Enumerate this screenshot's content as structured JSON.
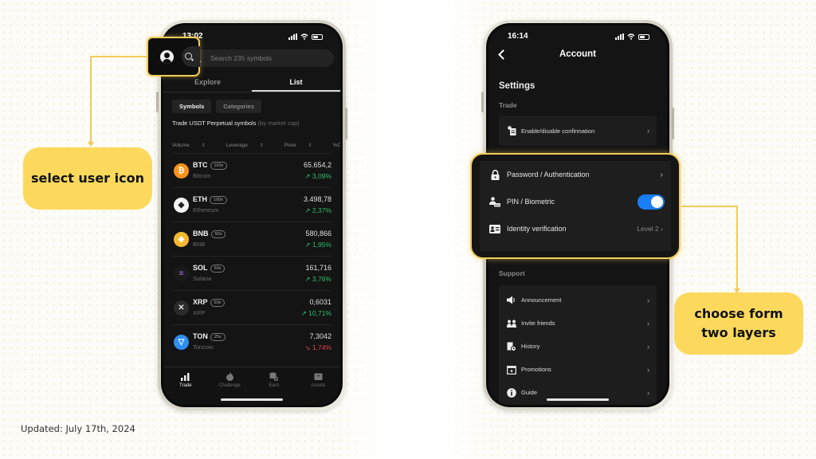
{
  "annotations": {
    "left_bubble": "select user icon",
    "right_bubble": "choose form two layers",
    "updated_label": "Updated: July 17th, 2024"
  },
  "phone_left": {
    "status_time": "13:02",
    "search_placeholder": "Search 235 symbols",
    "tabs": [
      {
        "label": "Explore",
        "active": false
      },
      {
        "label": "List",
        "active": true
      }
    ],
    "chips": [
      {
        "label": "Symbols",
        "active": true
      },
      {
        "label": "Categories",
        "active": false
      }
    ],
    "description": "Trade USDT Perpetual symbols",
    "description_muted": "(by market cap)",
    "column_headers": [
      "Volume",
      "Leverage",
      "Price",
      "%Change"
    ],
    "sort_glyph": "⇕",
    "coins": [
      {
        "symbol": "BTC",
        "leverage": "100x",
        "name": "Bitcoin",
        "price": "65.654,2",
        "change": "↗ 3,09%",
        "direction": "up",
        "logo_color": "#f7931a",
        "logo_glyph": "₿"
      },
      {
        "symbol": "ETH",
        "leverage": "100x",
        "name": "Ethereum",
        "price": "3.498,78",
        "change": "↗ 2,37%",
        "direction": "up",
        "logo_color": "#f4f4f4",
        "logo_glyph": "◆"
      },
      {
        "symbol": "BNB",
        "leverage": "50x",
        "name": "BNB",
        "price": "580,866",
        "change": "↗ 1,95%",
        "direction": "up",
        "logo_color": "#f3ba2f",
        "logo_glyph": "◈"
      },
      {
        "symbol": "SOL",
        "leverage": "50x",
        "name": "Solana",
        "price": "161,716",
        "change": "↗ 3,76%",
        "direction": "up",
        "logo_color": "#1a1a1a",
        "logo_glyph": "≡"
      },
      {
        "symbol": "XRP",
        "leverage": "50x",
        "name": "XRP",
        "price": "0,6031",
        "change": "↗ 10,71%",
        "direction": "up",
        "logo_color": "#2b2b2b",
        "logo_glyph": "✕"
      },
      {
        "symbol": "TON",
        "leverage": "25x",
        "name": "Toncoin",
        "price": "7,3042",
        "change": "↘ 1,74%",
        "direction": "down",
        "logo_color": "#2f8ff0",
        "logo_glyph": "▽"
      }
    ],
    "bottom_nav": [
      {
        "label": "Trade",
        "icon": "chart-bars-icon",
        "active": true
      },
      {
        "label": "Challenge",
        "icon": "flame-icon",
        "active": false
      },
      {
        "label": "Earn",
        "icon": "coins-icon",
        "active": false
      },
      {
        "label": "Assets",
        "icon": "wallet-icon",
        "active": false
      }
    ]
  },
  "phone_right": {
    "status_time": "16:14",
    "title": "Account",
    "settings_heading": "Settings",
    "trade_section_label": "Trade",
    "trade_items": [
      {
        "label": "Enable/disable confirmation",
        "icon": "clipboard-check-icon"
      }
    ],
    "security_items": [
      {
        "label": "Password / Authentication",
        "icon": "lock-icon",
        "trailing": "chevron"
      },
      {
        "label": "PIN / Biometric",
        "icon": "user-keypad-icon",
        "trailing": "toggle",
        "toggle_on": true
      },
      {
        "label": "Identity verification",
        "icon": "id-card-icon",
        "trailing": "value",
        "value": "Level 2"
      }
    ],
    "support_section_label": "Support",
    "support_items": [
      {
        "label": "Announcement",
        "icon": "speaker-icon"
      },
      {
        "label": "Invite friends",
        "icon": "users-icon"
      },
      {
        "label": "History",
        "icon": "history-doc-icon"
      },
      {
        "label": "Promotions",
        "icon": "calendar-star-icon"
      },
      {
        "label": "Guide",
        "icon": "info-icon"
      }
    ],
    "chevron_glyph": "›"
  },
  "colors": {
    "highlight": "#f5cd5a",
    "bubble": "#fcd95c",
    "up": "#2ebd6b",
    "down": "#e0424a",
    "toggle": "#1a7ef5"
  }
}
